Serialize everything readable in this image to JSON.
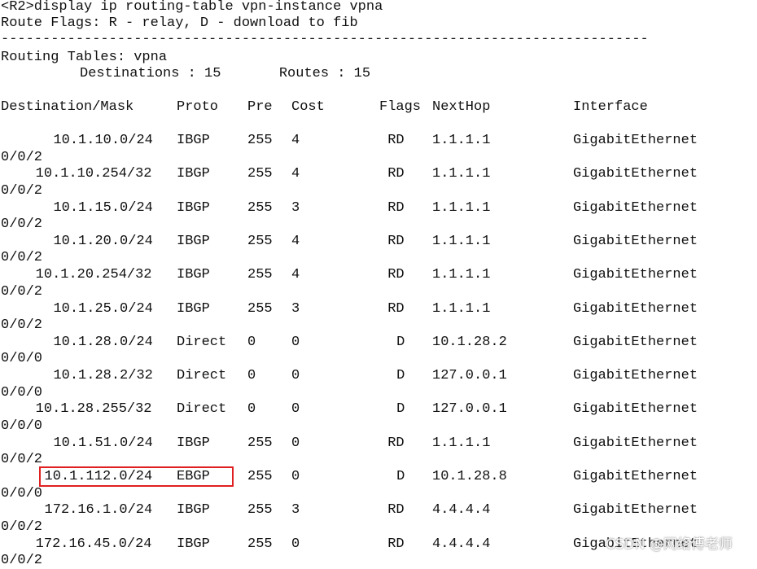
{
  "terminal": {
    "command": "<R2>display ip routing-table vpn-instance vpna",
    "flags_legend": "Route Flags: R - relay, D - download to fib",
    "separator": "------------------------------------------------------------------------------",
    "tables_title": "Routing Tables: vpna",
    "summary": "Destinations : 15       Routes : 15",
    "headers": {
      "dest": "Destination/Mask",
      "proto": "Proto",
      "pre": "Pre",
      "cost": "Cost",
      "flags": "Flags",
      "nexthop": "NextHop",
      "iface": "Interface"
    },
    "routes": [
      {
        "dest": "10.1.10.0/24",
        "proto": "IBGP",
        "pre": "255",
        "cost": "4",
        "flags": "RD",
        "nexthop": "1.1.1.1",
        "iface": "GigabitEthernet",
        "cont": "0/0/2"
      },
      {
        "dest": "10.1.10.254/32",
        "proto": "IBGP",
        "pre": "255",
        "cost": "4",
        "flags": "RD",
        "nexthop": "1.1.1.1",
        "iface": "GigabitEthernet",
        "cont": "0/0/2"
      },
      {
        "dest": "10.1.15.0/24",
        "proto": "IBGP",
        "pre": "255",
        "cost": "3",
        "flags": "RD",
        "nexthop": "1.1.1.1",
        "iface": "GigabitEthernet",
        "cont": "0/0/2"
      },
      {
        "dest": "10.1.20.0/24",
        "proto": "IBGP",
        "pre": "255",
        "cost": "4",
        "flags": "RD",
        "nexthop": "1.1.1.1",
        "iface": "GigabitEthernet",
        "cont": "0/0/2"
      },
      {
        "dest": "10.1.20.254/32",
        "proto": "IBGP",
        "pre": "255",
        "cost": "4",
        "flags": "RD",
        "nexthop": "1.1.1.1",
        "iface": "GigabitEthernet",
        "cont": "0/0/2"
      },
      {
        "dest": "10.1.25.0/24",
        "proto": "IBGP",
        "pre": "255",
        "cost": "3",
        "flags": "RD",
        "nexthop": "1.1.1.1",
        "iface": "GigabitEthernet",
        "cont": "0/0/2"
      },
      {
        "dest": "10.1.28.0/24",
        "proto": "Direct",
        "pre": "0",
        "cost": "0",
        "flags": "D",
        "nexthop": "10.1.28.2",
        "iface": "GigabitEthernet",
        "cont": "0/0/0"
      },
      {
        "dest": "10.1.28.2/32",
        "proto": "Direct",
        "pre": "0",
        "cost": "0",
        "flags": "D",
        "nexthop": "127.0.0.1",
        "iface": "GigabitEthernet",
        "cont": "0/0/0"
      },
      {
        "dest": "10.1.28.255/32",
        "proto": "Direct",
        "pre": "0",
        "cost": "0",
        "flags": "D",
        "nexthop": "127.0.0.1",
        "iface": "GigabitEthernet",
        "cont": "0/0/0"
      },
      {
        "dest": "10.1.51.0/24",
        "proto": "IBGP",
        "pre": "255",
        "cost": "0",
        "flags": "RD",
        "nexthop": "1.1.1.1",
        "iface": "GigabitEthernet",
        "cont": "0/0/2"
      },
      {
        "dest": "10.1.112.0/24",
        "proto": "EBGP",
        "pre": "255",
        "cost": "0",
        "flags": "D",
        "nexthop": "10.1.28.8",
        "iface": "GigabitEthernet",
        "cont": "0/0/0"
      },
      {
        "dest": "172.16.1.0/24",
        "proto": "IBGP",
        "pre": "255",
        "cost": "3",
        "flags": "RD",
        "nexthop": "4.4.4.4",
        "iface": "GigabitEthernet",
        "cont": "0/0/2"
      },
      {
        "dest": "172.16.45.0/24",
        "proto": "IBGP",
        "pre": "255",
        "cost": "0",
        "flags": "RD",
        "nexthop": "4.4.4.4",
        "iface": "GigabitEthernet",
        "cont": "0/0/2"
      }
    ],
    "highlighted_route_index": 10,
    "highlight_color": "#e02020"
  },
  "watermark": "CSDN @网络傅老师"
}
